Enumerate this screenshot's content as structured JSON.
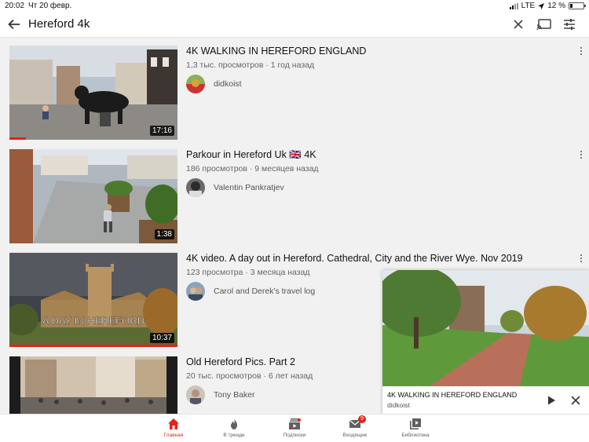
{
  "status": {
    "time": "20:02",
    "date": "Чт 20 февр.",
    "network": "LTE",
    "battery": "12 %"
  },
  "search": {
    "query": "Hereford 4k"
  },
  "results": [
    {
      "title": "4K WALKING IN HEREFORD ENGLAND",
      "meta": "1,3 тыс. просмотров · 1 год назад",
      "channel": "didkoist",
      "duration": "17:16",
      "watched_fraction": 0.1
    },
    {
      "title": "Parkour in Hereford Uk 🇬🇧 4K",
      "meta": "186 просмотров · 9 месяцев назад",
      "channel": "Valentin Pankratjev",
      "duration": "1:38",
      "watched_fraction": 0
    },
    {
      "title": "4K video. A day out in Hereford. Cathedral, City and the River Wye. Nov 2019",
      "meta": "123 просмотра · 3 месяца назад",
      "channel": "Carol and Derek's travel log",
      "duration": "10:37",
      "watched_fraction": 1.0,
      "thumb_caption": "A DAY IN HEREFORD"
    },
    {
      "title": "Old Hereford Pics. Part 2",
      "meta": "20 тыс. просмотров · 6 лет назад",
      "channel": "Tony Baker",
      "duration": "",
      "watched_fraction": 0
    }
  ],
  "miniplayer": {
    "title": "4K WALKING IN HEREFORD ENGLAND",
    "channel": "didkoist"
  },
  "nav": [
    {
      "label": "Главная",
      "icon": "home-icon",
      "active": true
    },
    {
      "label": "В тренде",
      "icon": "trending-icon",
      "active": false
    },
    {
      "label": "Подписки",
      "icon": "subscriptions-icon",
      "active": false
    },
    {
      "label": "Входящие",
      "icon": "inbox-icon",
      "active": false,
      "badge": "9"
    },
    {
      "label": "Библиотека",
      "icon": "library-icon",
      "active": false
    }
  ],
  "colors": {
    "accent": "#e62117",
    "background": "#f1f1f1"
  }
}
